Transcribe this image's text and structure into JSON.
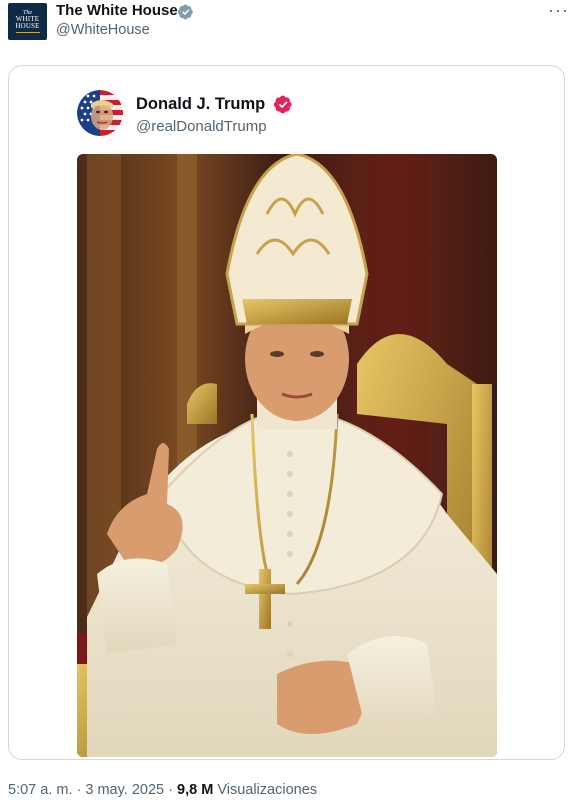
{
  "tweet": {
    "author_name": "The White House",
    "author_handle": "@WhiteHouse",
    "avatar": {
      "line1": "The",
      "line2": "WHITE",
      "line3": "HOUSE"
    },
    "verified_icon": "verified-gray-badge-icon",
    "more_label": "···"
  },
  "quote": {
    "author_name": "Donald J. Trump",
    "author_handle": "@realDonaldTrump",
    "verified_icon": "verified-red-badge-icon",
    "media": {
      "subject": "pope-image",
      "colors": {
        "background": "#5a2c1c",
        "robe": "#efe7d3",
        "gold": "#c8a24a"
      }
    }
  },
  "footer": {
    "time": "5:07 a. m.",
    "separator": "·",
    "date": "3 may. 2025",
    "views_count": "9,8 M",
    "views_label": "Visualizaciones"
  },
  "colors": {
    "muted": "#536471",
    "border": "#cfd9de",
    "text": "#0f1419",
    "badge_red": "#e0245e"
  }
}
